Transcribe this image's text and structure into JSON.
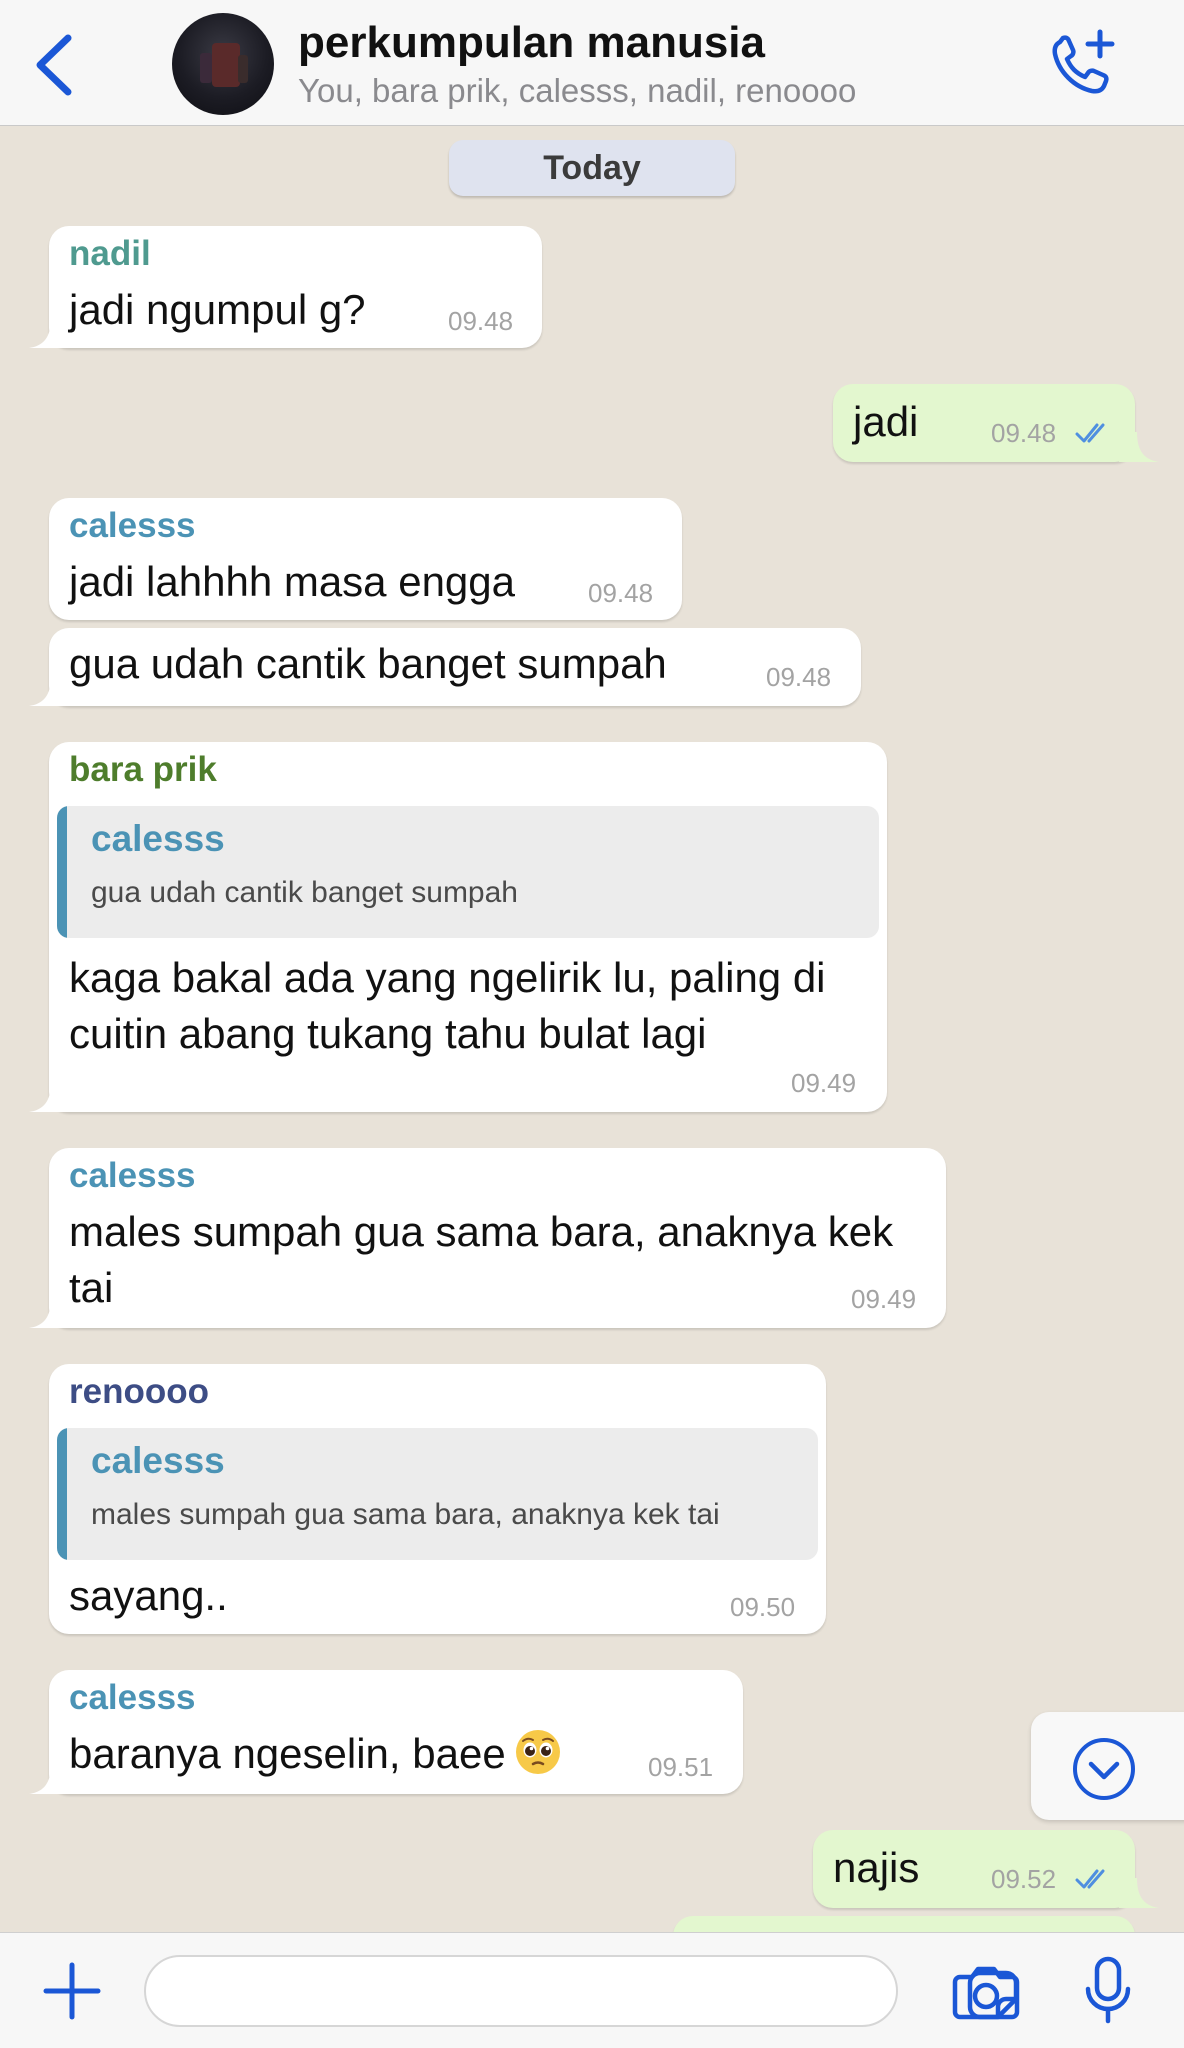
{
  "header": {
    "back_icon": "chevron-left-icon",
    "title": "perkumpulan manusia",
    "subtitle": "You, bara prik, calesss, nadil, renoooo",
    "call_icon": "phone-add-icon"
  },
  "date_separator": "Today",
  "messages": [
    {
      "direction": "in",
      "sender": "nadil",
      "sender_color": "#4f9a8f",
      "text": "jadi ngumpul g?",
      "time": "09.48"
    },
    {
      "direction": "out",
      "text": "jadi",
      "time": "09.48",
      "status": "read"
    },
    {
      "direction": "in",
      "sender": "calesss",
      "sender_color": "#4b93b5",
      "text": "jadi lahhhh masa engga",
      "time": "09.48"
    },
    {
      "direction": "in",
      "text": "gua udah cantik banget sumpah",
      "time": "09.48"
    },
    {
      "direction": "in",
      "sender": "bara prik",
      "sender_color": "#4e7d2c",
      "quote": {
        "name": "calesss",
        "text": "gua udah cantik banget sumpah"
      },
      "text_lines": [
        "kaga bakal ada yang ngelirik lu, paling di",
        "cuitin abang tukang tahu bulat lagi"
      ],
      "time": "09.49"
    },
    {
      "direction": "in",
      "sender": "calesss",
      "sender_color": "#4b93b5",
      "text_lines": [
        "males sumpah gua sama bara, anaknya kek",
        "tai"
      ],
      "time": "09.49"
    },
    {
      "direction": "in",
      "sender": "renoooo",
      "sender_color": "#3d4d85",
      "quote": {
        "name": "calesss",
        "text": "males sumpah gua sama bara, anaknya kek tai"
      },
      "text": "sayang..",
      "time": "09.50"
    },
    {
      "direction": "in",
      "sender": "calesss",
      "sender_color": "#4b93b5",
      "text": "baranya ngeselin, baee",
      "emoji": "pleading-face-emoji",
      "time": "09.51"
    },
    {
      "direction": "out",
      "text": "najis",
      "time": "09.52",
      "status": "read"
    }
  ],
  "scroll_down_icon": "chevron-down-circle-icon",
  "input_bar": {
    "plus_icon": "plus-icon",
    "input_placeholder": "",
    "sticker_icon": "sticker-icon",
    "camera_icon": "camera-icon",
    "mic_icon": "microphone-icon"
  },
  "colors": {
    "accent": "#1b57d6",
    "background": "#e8e2d8",
    "outgoing_bubble": "#e3f7cf",
    "incoming_bubble": "#ffffff",
    "read_tick": "#4f8fe0"
  }
}
